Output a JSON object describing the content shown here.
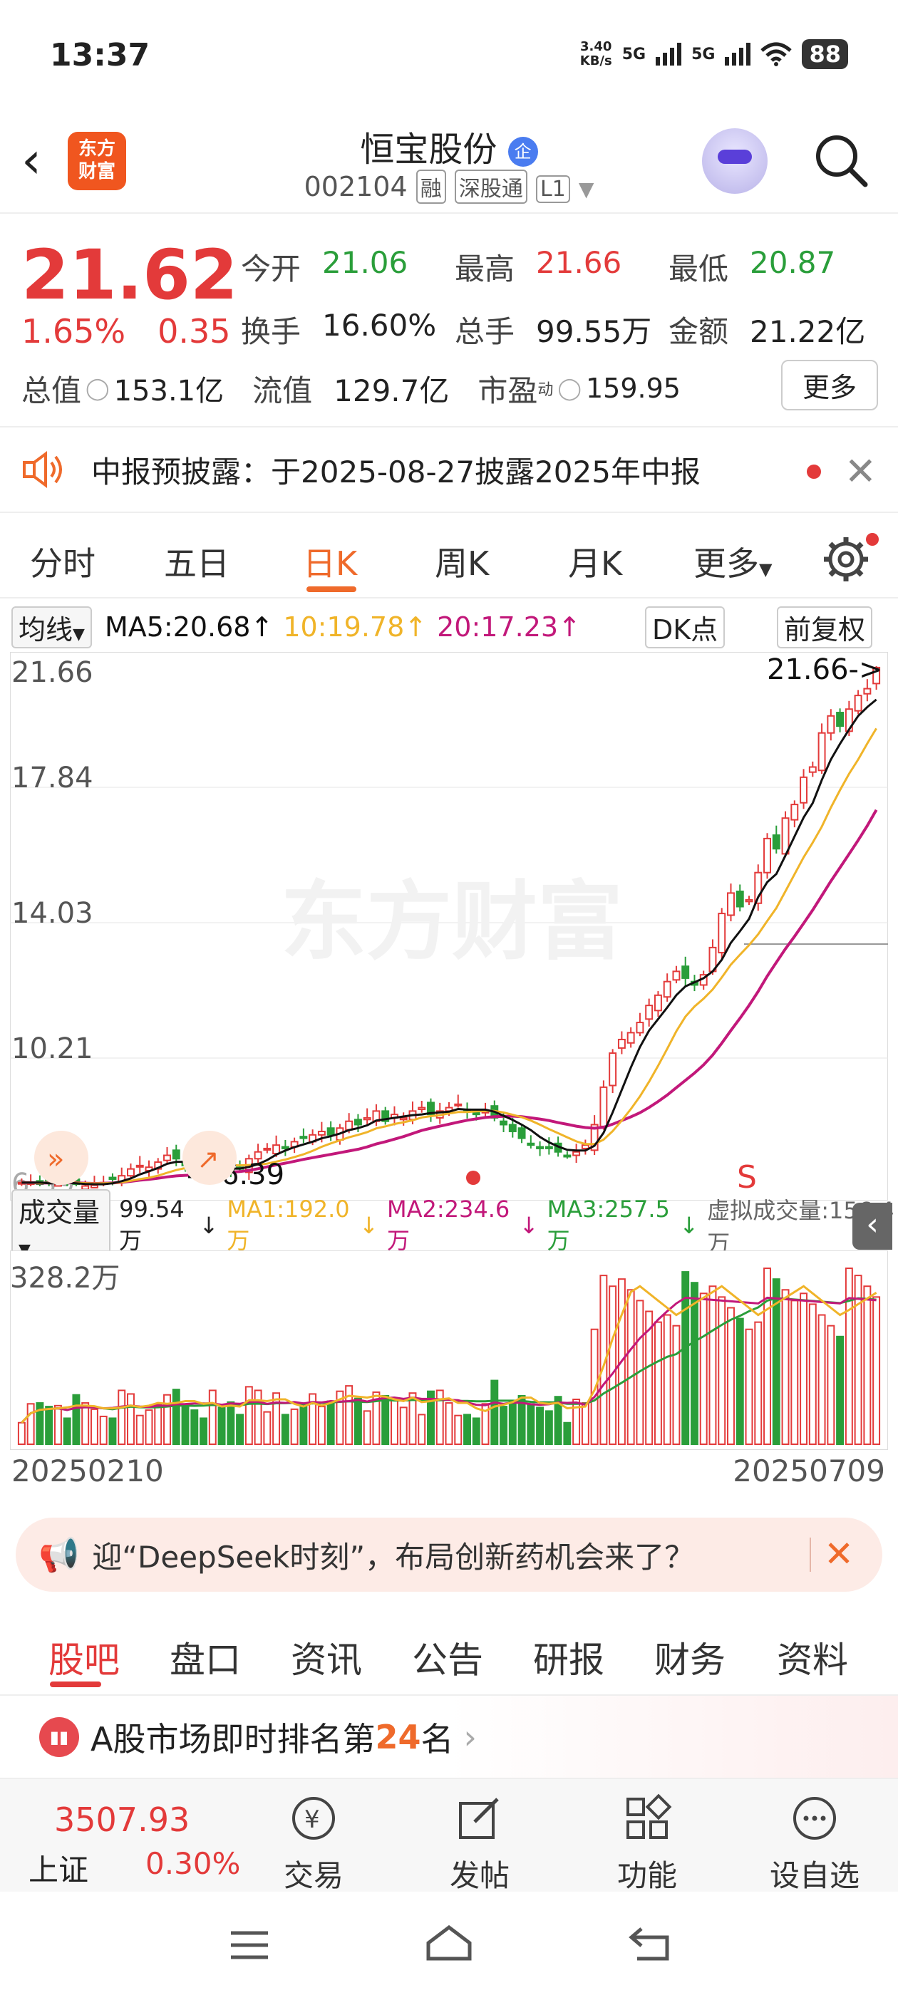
{
  "status_bar": {
    "time": "13:37",
    "net_speed": "3.40",
    "net_unit": "KB/s",
    "signal1": "5G",
    "signal2": "5G",
    "battery": "88"
  },
  "nav": {
    "logo_line1": "东方",
    "logo_line2": "财富",
    "title": "恒宝股份",
    "verified_badge": "企",
    "code": "002104",
    "tag1": "融",
    "tag2": "深股通",
    "tag3": "L1"
  },
  "quote": {
    "price": "21.62",
    "change_pct": "1.65%",
    "change_amt": "0.35",
    "fields": [
      [
        {
          "label": "今开",
          "value": "21.06",
          "color": "#2a9e3a"
        },
        {
          "label": "最高",
          "value": "21.66",
          "color": "#e33a3a"
        },
        {
          "label": "最低",
          "value": "20.87",
          "color": "#2a9e3a"
        }
      ],
      [
        {
          "label": "换手",
          "value": "16.60%",
          "color": "#222"
        },
        {
          "label": "总手",
          "value": "99.55万",
          "color": "#222"
        },
        {
          "label": "金额",
          "value": "21.22亿",
          "color": "#222"
        }
      ]
    ],
    "total_value_label": "总值",
    "total_value": "153.1亿",
    "float_value_label": "流值",
    "float_value": "129.7亿",
    "pe_label": "市盈",
    "pe_sup": "动",
    "pe_value": "159.95",
    "more_button": "更多"
  },
  "notice": {
    "text": "中报预披露：于2025-08-27披露2025年中报"
  },
  "chart_tabs": [
    "分时",
    "五日",
    "日K",
    "周K",
    "月K",
    "更多"
  ],
  "chart_active_tab": "日K",
  "ma_bar": {
    "selector": "均线",
    "ma5": "MA5:20.68",
    "ma10": "10:19.78",
    "ma20": "20:17.23",
    "dk": "DK点",
    "adjust": "前复权"
  },
  "chart": {
    "watermark": "东方财富",
    "y_labels": [
      "21.66",
      "17.84",
      "14.03",
      "10.21",
      "6.39"
    ],
    "high_marker": "21.66->",
    "low_marker": "6.39",
    "signal_s": "S"
  },
  "volume_bar": {
    "selector": "成交量",
    "vol": "99.54万",
    "ma1": "MA1:192.0万",
    "ma2": "MA2:234.6万",
    "ma3": "MA3:257.5万",
    "virtual": "虚拟成交量:156.4万"
  },
  "volume_chart": {
    "y_label": "328.2万"
  },
  "dates": {
    "start": "20250210",
    "end": "20250709"
  },
  "banner": {
    "text": "迎“DeepSeek时刻”，布局创新药机会来了？"
  },
  "footer_tabs": [
    "股吧",
    "盘口",
    "资讯",
    "公告",
    "研报",
    "财务",
    "资料"
  ],
  "rank": {
    "prefix": "A股市场即时排名第",
    "number": "24",
    "suffix": "名"
  },
  "bottom_bar": {
    "index_value": "3507.93",
    "index_name": "上证",
    "index_change": "0.30%",
    "items": [
      "交易",
      "发帖",
      "功能",
      "设自选"
    ]
  },
  "colors": {
    "up": "#e33a3a",
    "down": "#2a9e3a",
    "accent": "#ef6a2b",
    "ma5": "#111111",
    "ma10": "#f0b429",
    "ma20": "#c2187a"
  },
  "chart_data": {
    "type": "candlestick",
    "ylim": [
      6.39,
      21.66
    ],
    "x_range": [
      "20250210",
      "20250709"
    ],
    "close": [
      6.5,
      6.5,
      6.45,
      6.5,
      6.55,
      6.5,
      6.45,
      6.4,
      6.42,
      6.5,
      6.6,
      6.7,
      6.9,
      7.0,
      6.95,
      7.1,
      7.3,
      7.2,
      7.0,
      6.9,
      6.95,
      7.0,
      6.9,
      6.8,
      6.9,
      7.2,
      7.4,
      7.5,
      7.6,
      7.5,
      7.7,
      7.8,
      7.9,
      8.0,
      7.9,
      8.1,
      8.3,
      8.2,
      8.4,
      8.6,
      8.3,
      8.5,
      8.4,
      8.6,
      8.7,
      8.5,
      8.6,
      8.7,
      8.8,
      8.6,
      8.5,
      8.6,
      8.4,
      8.2,
      8.0,
      7.8,
      7.6,
      7.5,
      7.5,
      7.4,
      7.3,
      7.4,
      7.6,
      8.2,
      9.3,
      10.3,
      10.7,
      10.9,
      11.2,
      11.7,
      12.0,
      12.4,
      12.7,
      12.5,
      12.3,
      12.6,
      13.4,
      14.4,
      15.0,
      14.6,
      14.8,
      15.6,
      16.6,
      16.3,
      17.2,
      17.6,
      18.4,
      18.7,
      19.7,
      20.2,
      19.9,
      20.4,
      20.8,
      21.0,
      21.62
    ],
    "ma5": [
      6.5,
      6.5,
      6.5,
      6.48,
      6.48,
      6.5,
      6.48,
      6.46,
      6.45,
      6.45,
      6.48,
      6.54,
      6.62,
      6.74,
      6.83,
      6.93,
      7.05,
      7.11,
      7.11,
      7.1,
      7.07,
      7.01,
      6.95,
      6.91,
      6.91,
      6.96,
      7.04,
      7.16,
      7.32,
      7.44,
      7.54,
      7.62,
      7.7,
      7.8,
      7.86,
      7.94,
      8.04,
      8.1,
      8.18,
      8.32,
      8.36,
      8.4,
      8.44,
      8.48,
      8.5,
      8.54,
      8.56,
      8.58,
      8.66,
      8.64,
      8.64,
      8.64,
      8.58,
      8.46,
      8.34,
      8.2,
      8.04,
      7.84,
      7.68,
      7.56,
      7.46,
      7.44,
      7.44,
      7.58,
      7.96,
      8.56,
      9.22,
      9.88,
      10.48,
      10.96,
      11.3,
      11.64,
      12.0,
      12.26,
      12.38,
      12.5,
      12.7,
      13.04,
      13.54,
      13.88,
      14.24,
      14.88,
      15.32,
      15.56,
      16.1,
      16.66,
      17.22,
      17.64,
      18.32,
      18.92,
      19.38,
      19.8,
      20.2,
      20.46,
      20.68
    ]
  }
}
